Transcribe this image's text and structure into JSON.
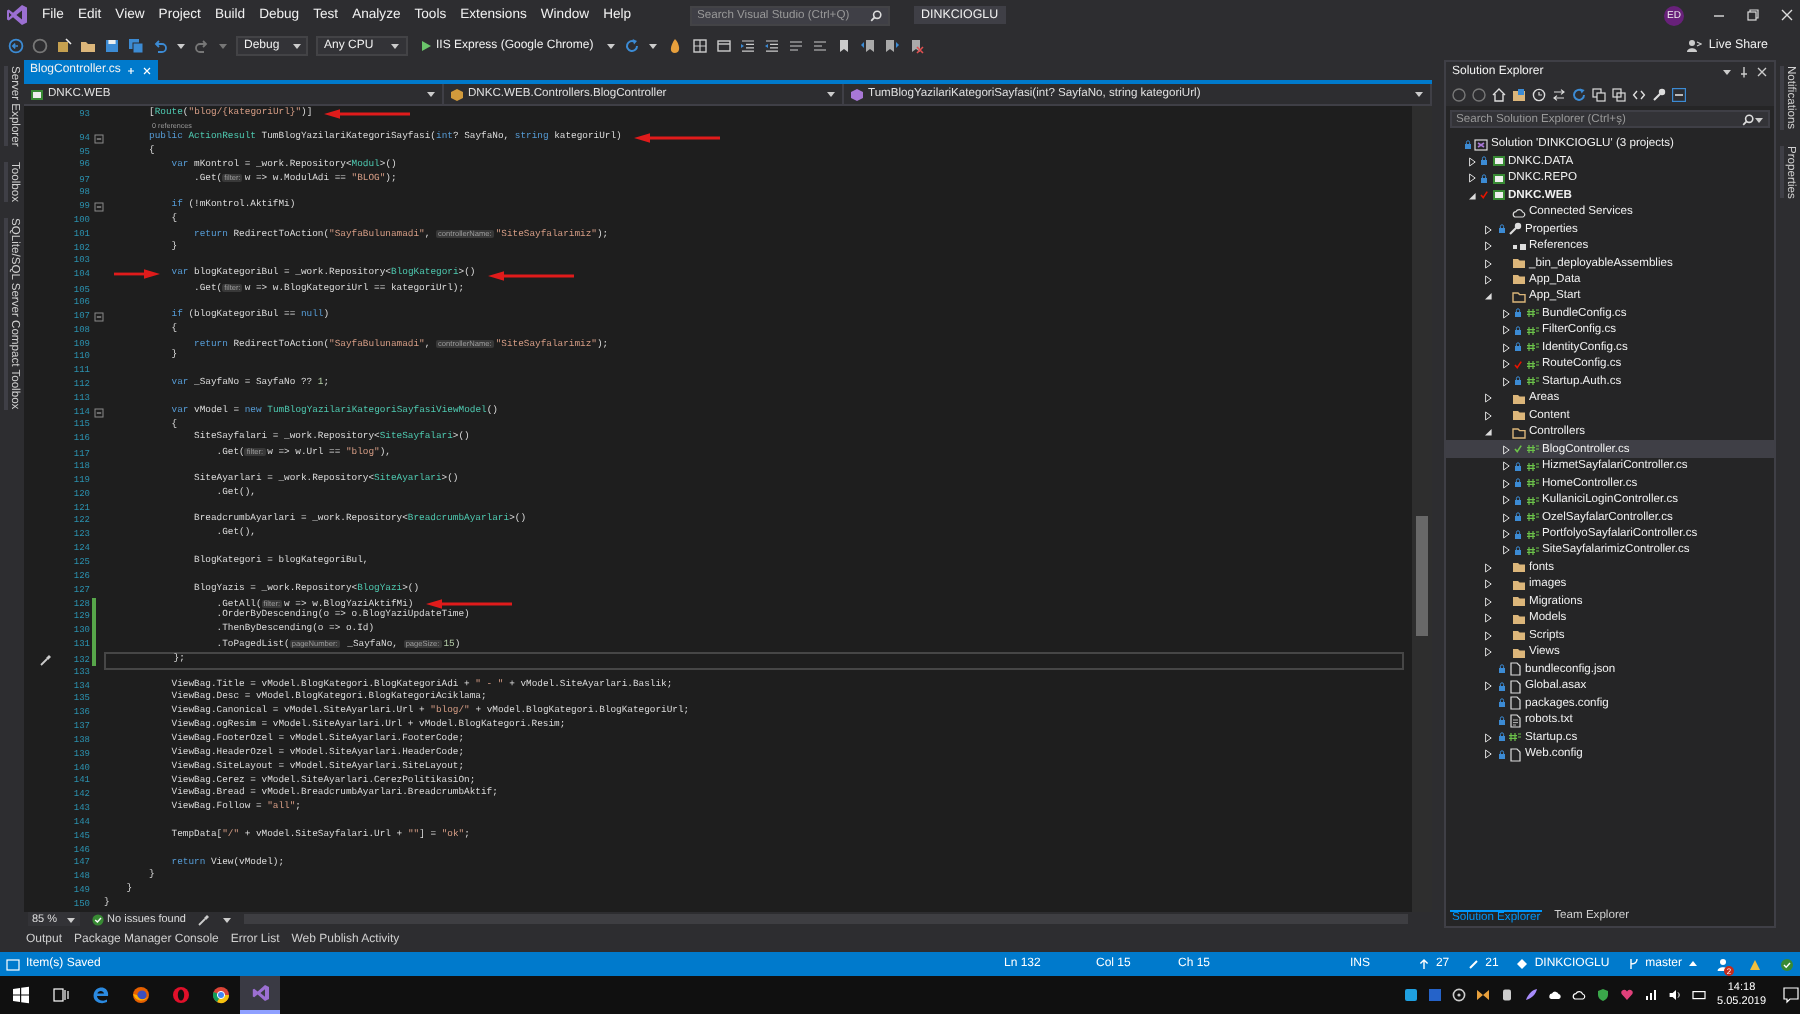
{
  "menu_bar": {
    "items": [
      "File",
      "Edit",
      "View",
      "Project",
      "Build",
      "Debug",
      "Test",
      "Analyze",
      "Tools",
      "Extensions",
      "Window",
      "Help"
    ],
    "search": {
      "placeholder": "Search Visual Studio (Ctrl+Q)"
    },
    "solution_name": "DINKCIOGLU",
    "account": {
      "initials": "ED"
    }
  },
  "toolbar": {
    "configuration": "Debug",
    "platform": "Any CPU",
    "run_target": "IIS Express (Google Chrome)",
    "live_share": "Live Share"
  },
  "left_tool_strip": [
    "Server Explorer",
    "Toolbox",
    "SQLite/SQL Server Compact Toolbox"
  ],
  "right_tool_strip": [
    "Notifications",
    "Properties"
  ],
  "editor": {
    "tabs": [
      {
        "label": "BlogController.cs",
        "selected": true
      }
    ],
    "navigation": [
      {
        "kind": "project",
        "label": "DNKC.WEB"
      },
      {
        "kind": "class",
        "label": "DNKC.WEB.Controllers.BlogController"
      },
      {
        "kind": "method",
        "label": "TumBlogYazilariKategoriSayfasi(int? SayfaNo, string kategoriUrl)"
      }
    ],
    "lines": [
      {
        "number": "93",
        "arrow_after": true,
        "tokens": [
          {
            "kind": "plain",
            "text": "        ["
          },
          {
            "kind": "type",
            "text": "Route"
          },
          {
            "kind": "plain",
            "text": "("
          },
          {
            "kind": "string",
            "text": "\"blog/{kategoriUrl}\""
          },
          {
            "kind": "plain",
            "text": ")]"
          }
        ]
      },
      {
        "number": "94",
        "lens": "0 references",
        "fold": true,
        "arrow_after": true,
        "tokens": [
          {
            "kind": "keyword",
            "text": "        public"
          },
          {
            "kind": "type",
            "text": " ActionResult"
          },
          {
            "kind": "plain",
            "text": " TumBlogYazilariKategoriSayfasi("
          },
          {
            "kind": "keyword",
            "text": "int"
          },
          {
            "kind": "plain",
            "text": "? SayfaNo, "
          },
          {
            "kind": "keyword",
            "text": "string"
          },
          {
            "kind": "plain",
            "text": " kategoriUrl)"
          }
        ]
      },
      {
        "number": "95",
        "tokens": [
          {
            "kind": "plain",
            "text": "        {"
          }
        ]
      },
      {
        "number": "96",
        "tokens": [
          {
            "kind": "keyword",
            "text": "            var"
          },
          {
            "kind": "plain",
            "text": " mKontrol = _work.Repository<"
          },
          {
            "kind": "type",
            "text": "Modul"
          },
          {
            "kind": "plain",
            "text": ">()"
          }
        ]
      },
      {
        "number": "97",
        "tokens": [
          {
            "kind": "plain",
            "text": "                .Get("
          },
          {
            "kind": "hint",
            "text": "filter:"
          },
          {
            "kind": "plain",
            "text": "w => w.ModulAdi == "
          },
          {
            "kind": "string",
            "text": "\"BLOG\""
          },
          {
            "kind": "plain",
            "text": ");"
          }
        ]
      },
      {
        "number": "98"
      },
      {
        "number": "99",
        "fold": true,
        "tokens": [
          {
            "kind": "keyword",
            "text": "            if"
          },
          {
            "kind": "plain",
            "text": " (!mKontrol.AktifMi)"
          }
        ]
      },
      {
        "number": "100",
        "tokens": [
          {
            "kind": "plain",
            "text": "            {"
          }
        ]
      },
      {
        "number": "101",
        "tokens": [
          {
            "kind": "keyword",
            "text": "                return"
          },
          {
            "kind": "plain",
            "text": " RedirectToAction("
          },
          {
            "kind": "string",
            "text": "\"SayfaBulunamadi\""
          },
          {
            "kind": "plain",
            "text": ", "
          },
          {
            "kind": "hint",
            "text": "controllerName:"
          },
          {
            "kind": "string",
            "text": "\"SiteSayfalarimiz\""
          },
          {
            "kind": "plain",
            "text": ");"
          }
        ]
      },
      {
        "number": "102",
        "tokens": [
          {
            "kind": "plain",
            "text": "            }"
          }
        ]
      },
      {
        "number": "103"
      },
      {
        "number": "104",
        "arrow_before": true,
        "arrow_after": true,
        "tokens": [
          {
            "kind": "keyword",
            "text": "            var"
          },
          {
            "kind": "plain",
            "text": " blogKategoriBul = _work.Repository<"
          },
          {
            "kind": "type",
            "text": "BlogKategori"
          },
          {
            "kind": "plain",
            "text": ">()"
          }
        ]
      },
      {
        "number": "105",
        "tokens": [
          {
            "kind": "plain",
            "text": "                .Get("
          },
          {
            "kind": "hint",
            "text": "filter:"
          },
          {
            "kind": "plain",
            "text": "w => w.BlogKategoriUrl == kategoriUrl);"
          }
        ]
      },
      {
        "number": "106"
      },
      {
        "number": "107",
        "fold": true,
        "tokens": [
          {
            "kind": "keyword",
            "text": "            if"
          },
          {
            "kind": "plain",
            "text": " (blogKategoriBul == "
          },
          {
            "kind": "keyword",
            "text": "null"
          },
          {
            "kind": "plain",
            "text": ")"
          }
        ]
      },
      {
        "number": "108",
        "tokens": [
          {
            "kind": "plain",
            "text": "            {"
          }
        ]
      },
      {
        "number": "109",
        "tokens": [
          {
            "kind": "keyword",
            "text": "                return"
          },
          {
            "kind": "plain",
            "text": " RedirectToAction("
          },
          {
            "kind": "string",
            "text": "\"SayfaBulunamadi\""
          },
          {
            "kind": "plain",
            "text": ", "
          },
          {
            "kind": "hint",
            "text": "controllerName:"
          },
          {
            "kind": "string",
            "text": "\"SiteSayfalarimiz\""
          },
          {
            "kind": "plain",
            "text": ");"
          }
        ]
      },
      {
        "number": "110",
        "tokens": [
          {
            "kind": "plain",
            "text": "            }"
          }
        ]
      },
      {
        "number": "111"
      },
      {
        "number": "112",
        "tokens": [
          {
            "kind": "keyword",
            "text": "            var"
          },
          {
            "kind": "plain",
            "text": " _SayfaNo = SayfaNo ?? "
          },
          {
            "kind": "number",
            "text": "1"
          },
          {
            "kind": "plain",
            "text": ";"
          }
        ]
      },
      {
        "number": "113"
      },
      {
        "number": "114",
        "fold": true,
        "tokens": [
          {
            "kind": "keyword",
            "text": "            var"
          },
          {
            "kind": "plain",
            "text": " vModel = "
          },
          {
            "kind": "keyword",
            "text": "new"
          },
          {
            "kind": "type",
            "text": " TumBlogYazilariKategoriSayfasiViewModel"
          },
          {
            "kind": "plain",
            "text": "()"
          }
        ]
      },
      {
        "number": "115",
        "tokens": [
          {
            "kind": "plain",
            "text": "            {"
          }
        ]
      },
      {
        "number": "116",
        "tokens": [
          {
            "kind": "plain",
            "text": "                SiteSayfalari = _work.Repository<"
          },
          {
            "kind": "type",
            "text": "SiteSayfalari"
          },
          {
            "kind": "plain",
            "text": ">()"
          }
        ]
      },
      {
        "number": "117",
        "tokens": [
          {
            "kind": "plain",
            "text": "                    .Get("
          },
          {
            "kind": "hint",
            "text": "filter:"
          },
          {
            "kind": "plain",
            "text": "w => w.Url == "
          },
          {
            "kind": "string",
            "text": "\"blog\""
          },
          {
            "kind": "plain",
            "text": "),"
          }
        ]
      },
      {
        "number": "118"
      },
      {
        "number": "119",
        "tokens": [
          {
            "kind": "plain",
            "text": "                SiteAyarlari = _work.Repository<"
          },
          {
            "kind": "type",
            "text": "SiteAyarlari"
          },
          {
            "kind": "plain",
            "text": ">()"
          }
        ]
      },
      {
        "number": "120",
        "tokens": [
          {
            "kind": "plain",
            "text": "                    .Get(),"
          }
        ]
      },
      {
        "number": "121"
      },
      {
        "number": "122",
        "tokens": [
          {
            "kind": "plain",
            "text": "                BreadcrumbAyarlari = _work.Repository<"
          },
          {
            "kind": "type",
            "text": "BreadcrumbAyarlari"
          },
          {
            "kind": "plain",
            "text": ">()"
          }
        ]
      },
      {
        "number": "123",
        "tokens": [
          {
            "kind": "plain",
            "text": "                    .Get(),"
          }
        ]
      },
      {
        "number": "124"
      },
      {
        "number": "125",
        "tokens": [
          {
            "kind": "plain",
            "text": "                BlogKategori = blogKategoriBul,"
          }
        ]
      },
      {
        "number": "126"
      },
      {
        "number": "127",
        "tokens": [
          {
            "kind": "plain",
            "text": "                BlogYazis = _work.Repository<"
          },
          {
            "kind": "type",
            "text": "BlogYazi"
          },
          {
            "kind": "plain",
            "text": ">()"
          }
        ]
      },
      {
        "number": "128",
        "changed": true,
        "arrow_after": true,
        "tokens": [
          {
            "kind": "plain",
            "text": "                    .GetAll("
          },
          {
            "kind": "hint",
            "text": "filter:"
          },
          {
            "kind": "plain",
            "text": "w => w.BlogYaziAktifMi)"
          }
        ]
      },
      {
        "number": "129",
        "changed": true,
        "tokens": [
          {
            "kind": "plain",
            "text": "                    .OrderByDescending(o => o.BlogYaziUpdateTime)"
          }
        ]
      },
      {
        "number": "130",
        "changed": true,
        "tokens": [
          {
            "kind": "plain",
            "text": "                    .ThenByDescending(o => o.Id)"
          }
        ]
      },
      {
        "number": "131",
        "changed": true,
        "tokens": [
          {
            "kind": "plain",
            "text": "                    .ToPagedList("
          },
          {
            "kind": "hint",
            "text": "pageNumber:"
          },
          {
            "kind": "plain",
            "text": " _SayfaNo, "
          },
          {
            "kind": "hint",
            "text": "pageSize:"
          },
          {
            "kind": "number",
            "text": "15"
          },
          {
            "kind": "plain",
            "text": ")"
          }
        ]
      },
      {
        "number": "132",
        "changed": true,
        "current": true,
        "tokens": [
          {
            "kind": "plain",
            "text": "            };"
          }
        ]
      },
      {
        "number": "133"
      },
      {
        "number": "134",
        "tokens": [
          {
            "kind": "plain",
            "text": "            ViewBag.Title = vModel.BlogKategori.BlogKategoriAdi + "
          },
          {
            "kind": "string",
            "text": "\" - \""
          },
          {
            "kind": "plain",
            "text": " + vModel.SiteAyarlari.Baslik;"
          }
        ]
      },
      {
        "number": "135",
        "tokens": [
          {
            "kind": "plain",
            "text": "            ViewBag.Desc = vModel.BlogKategori.BlogKategoriAciklama;"
          }
        ]
      },
      {
        "number": "136",
        "tokens": [
          {
            "kind": "plain",
            "text": "            ViewBag.Canonical = vModel.SiteAyarlari.Url + "
          },
          {
            "kind": "string",
            "text": "\"blog/\""
          },
          {
            "kind": "plain",
            "text": " + vModel.BlogKategori.BlogKategoriUrl;"
          }
        ]
      },
      {
        "number": "137",
        "tokens": [
          {
            "kind": "plain",
            "text": "            ViewBag.ogResim = vModel.SiteAyarlari.Url + vModel.BlogKategori.Resim;"
          }
        ]
      },
      {
        "number": "138",
        "tokens": [
          {
            "kind": "plain",
            "text": "            ViewBag.FooterOzel = vModel.SiteAyarlari.FooterCode;"
          }
        ]
      },
      {
        "number": "139",
        "tokens": [
          {
            "kind": "plain",
            "text": "            ViewBag.HeaderOzel = vModel.SiteAyarlari.HeaderCode;"
          }
        ]
      },
      {
        "number": "140",
        "tokens": [
          {
            "kind": "plain",
            "text": "            ViewBag.SiteLayout = vModel.SiteAyarlari.SiteLayout;"
          }
        ]
      },
      {
        "number": "141",
        "tokens": [
          {
            "kind": "plain",
            "text": "            ViewBag.Cerez = vModel.SiteAyarlari.CerezPolitikasiOn;"
          }
        ]
      },
      {
        "number": "142",
        "tokens": [
          {
            "kind": "plain",
            "text": "            ViewBag.Bread = vModel.BreadcrumbAyarlari.BreadcrumbAktif;"
          }
        ]
      },
      {
        "number": "143",
        "tokens": [
          {
            "kind": "plain",
            "text": "            ViewBag.Follow = "
          },
          {
            "kind": "string",
            "text": "\"all\""
          },
          {
            "kind": "plain",
            "text": ";"
          }
        ]
      },
      {
        "number": "144"
      },
      {
        "number": "145",
        "tokens": [
          {
            "kind": "plain",
            "text": "            TempData["
          },
          {
            "kind": "string",
            "text": "\"/\""
          },
          {
            "kind": "plain",
            "text": " + vModel.SiteSayfalari.Url + "
          },
          {
            "kind": "string",
            "text": "\"\""
          },
          {
            "kind": "plain",
            "text": "] = "
          },
          {
            "kind": "string",
            "text": "\"ok\""
          },
          {
            "kind": "plain",
            "text": ";"
          }
        ]
      },
      {
        "number": "146"
      },
      {
        "number": "147",
        "tokens": [
          {
            "kind": "keyword",
            "text": "            return"
          },
          {
            "kind": "plain",
            "text": " View(vModel);"
          }
        ]
      },
      {
        "number": "148",
        "tokens": [
          {
            "kind": "plain",
            "text": "        }"
          }
        ]
      },
      {
        "number": "149",
        "tokens": [
          {
            "kind": "plain",
            "text": "    }"
          }
        ]
      },
      {
        "number": "150",
        "tokens": [
          {
            "kind": "plain",
            "text": "}"
          }
        ]
      }
    ],
    "zoom": "85 %",
    "issues": "No issues found"
  },
  "solution_explorer": {
    "title": "Solution Explorer",
    "search": {
      "placeholder": "Search Solution Explorer (Ctrl+ş)"
    },
    "tree": [
      {
        "label": "Solution 'DINKCIOGLU' (3 projects)",
        "kind": "solution",
        "locked": true,
        "selected": false,
        "children": [
          {
            "label": "DNKC.DATA",
            "kind": "project",
            "locked": true,
            "expanded": false,
            "startup": false,
            "selected": false
          },
          {
            "label": "DNKC.REPO",
            "kind": "project",
            "locked": true,
            "expanded": false,
            "startup": false,
            "selected": false
          },
          {
            "label": "DNKC.WEB",
            "kind": "project",
            "locked": false,
            "modified": true,
            "expanded": true,
            "startup": true,
            "selected": false,
            "children": [
              {
                "label": "Connected Services",
                "kind": "services",
                "selected": false
              },
              {
                "label": "Properties",
                "kind": "properties",
                "locked": true,
                "expanded": false,
                "selected": false
              },
              {
                "label": "References",
                "kind": "references",
                "expanded": false,
                "selected": false
              },
              {
                "label": "_bin_deployableAssemblies",
                "kind": "folder",
                "expanded": false,
                "selected": false
              },
              {
                "label": "App_Data",
                "kind": "folder",
                "expanded": false,
                "selected": false
              },
              {
                "label": "App_Start",
                "kind": "folder",
                "expanded": true,
                "selected": false,
                "children": [
                  {
                    "label": "BundleConfig.cs",
                    "kind": "cs",
                    "locked": true,
                    "expanded": false,
                    "selected": false
                  },
                  {
                    "label": "FilterConfig.cs",
                    "kind": "cs",
                    "locked": true,
                    "expanded": false,
                    "selected": false
                  },
                  {
                    "label": "IdentityConfig.cs",
                    "kind": "cs",
                    "locked": true,
                    "expanded": false,
                    "selected": false
                  },
                  {
                    "label": "RouteConfig.cs",
                    "kind": "cs",
                    "locked": false,
                    "modified": true,
                    "expanded": false,
                    "selected": false
                  },
                  {
                    "label": "Startup.Auth.cs",
                    "kind": "cs",
                    "locked": true,
                    "expanded": false,
                    "selected": false
                  }
                ]
              },
              {
                "label": "Areas",
                "kind": "folder",
                "expanded": false,
                "selected": false
              },
              {
                "label": "Content",
                "kind": "folder",
                "expanded": false,
                "selected": false
              },
              {
                "label": "Controllers",
                "kind": "folder",
                "expanded": true,
                "selected": false,
                "children": [
                  {
                    "label": "BlogController.cs",
                    "kind": "cs",
                    "locked": false,
                    "modified": true,
                    "staged": true,
                    "expanded": false,
                    "selected": true
                  },
                  {
                    "label": "HizmetSayfalariController.cs",
                    "kind": "cs",
                    "locked": true,
                    "expanded": false,
                    "selected": false
                  },
                  {
                    "label": "HomeController.cs",
                    "kind": "cs",
                    "locked": true,
                    "expanded": false,
                    "selected": false
                  },
                  {
                    "label": "KullaniciLoginController.cs",
                    "kind": "cs",
                    "locked": true,
                    "expanded": false,
                    "selected": false
                  },
                  {
                    "label": "OzelSayfalarController.cs",
                    "kind": "cs",
                    "locked": true,
                    "expanded": false,
                    "selected": false
                  },
                  {
                    "label": "PortfolyoSayfalariController.cs",
                    "kind": "cs",
                    "locked": true,
                    "expanded": false,
                    "selected": false
                  },
                  {
                    "label": "SiteSayfalarimizController.cs",
                    "kind": "cs",
                    "locked": true,
                    "expanded": false,
                    "selected": false
                  }
                ]
              },
              {
                "label": "fonts",
                "kind": "folder",
                "expanded": false,
                "selected": false
              },
              {
                "label": "images",
                "kind": "folder",
                "expanded": false,
                "selected": false
              },
              {
                "label": "Migrations",
                "kind": "folder",
                "expanded": false,
                "selected": false
              },
              {
                "label": "Models",
                "kind": "folder",
                "expanded": false,
                "selected": false
              },
              {
                "label": "Scripts",
                "kind": "folder",
                "expanded": false,
                "selected": false
              },
              {
                "label": "Views",
                "kind": "folder",
                "expanded": false,
                "selected": false
              },
              {
                "label": "bundleconfig.json",
                "kind": "file",
                "locked": true,
                "selected": false
              },
              {
                "label": "Global.asax",
                "kind": "file",
                "locked": true,
                "expanded": false,
                "selected": false
              },
              {
                "label": "packages.config",
                "kind": "file",
                "locked": true,
                "selected": false
              },
              {
                "label": "robots.txt",
                "kind": "text",
                "locked": true,
                "selected": false
              },
              {
                "label": "Startup.cs",
                "kind": "cs",
                "locked": true,
                "expanded": false,
                "selected": false
              },
              {
                "label": "Web.config",
                "kind": "file",
                "locked": true,
                "expanded": false,
                "selected": false
              }
            ]
          }
        ]
      }
    ],
    "tabs": [
      {
        "label": "Solution Explorer",
        "selected": true
      },
      {
        "label": "Team Explorer",
        "selected": false
      }
    ]
  },
  "bottom_tabs": [
    {
      "label": "Output",
      "selected": false
    },
    {
      "label": "Package Manager Console",
      "selected": false
    },
    {
      "label": "Error List",
      "selected": false
    },
    {
      "label": "Web Publish Activity",
      "selected": false
    }
  ],
  "status_bar": {
    "message": "Item(s) Saved",
    "line": "Ln 132",
    "column": "Col 15",
    "char": "Ch 15",
    "mode": "INS",
    "pushes": "27",
    "changes": "21",
    "repository": "DINKCIOGLU",
    "branch": "master",
    "notifications": "2"
  },
  "taskbar": {
    "apps": [
      {
        "kind": "edge",
        "selected": false
      },
      {
        "kind": "firefox",
        "selected": false
      },
      {
        "kind": "opera",
        "selected": false
      },
      {
        "kind": "chrome",
        "selected": false
      },
      {
        "kind": "visualstudio",
        "selected": true
      }
    ],
    "time": "14:18",
    "date": "5.05.2019"
  }
}
